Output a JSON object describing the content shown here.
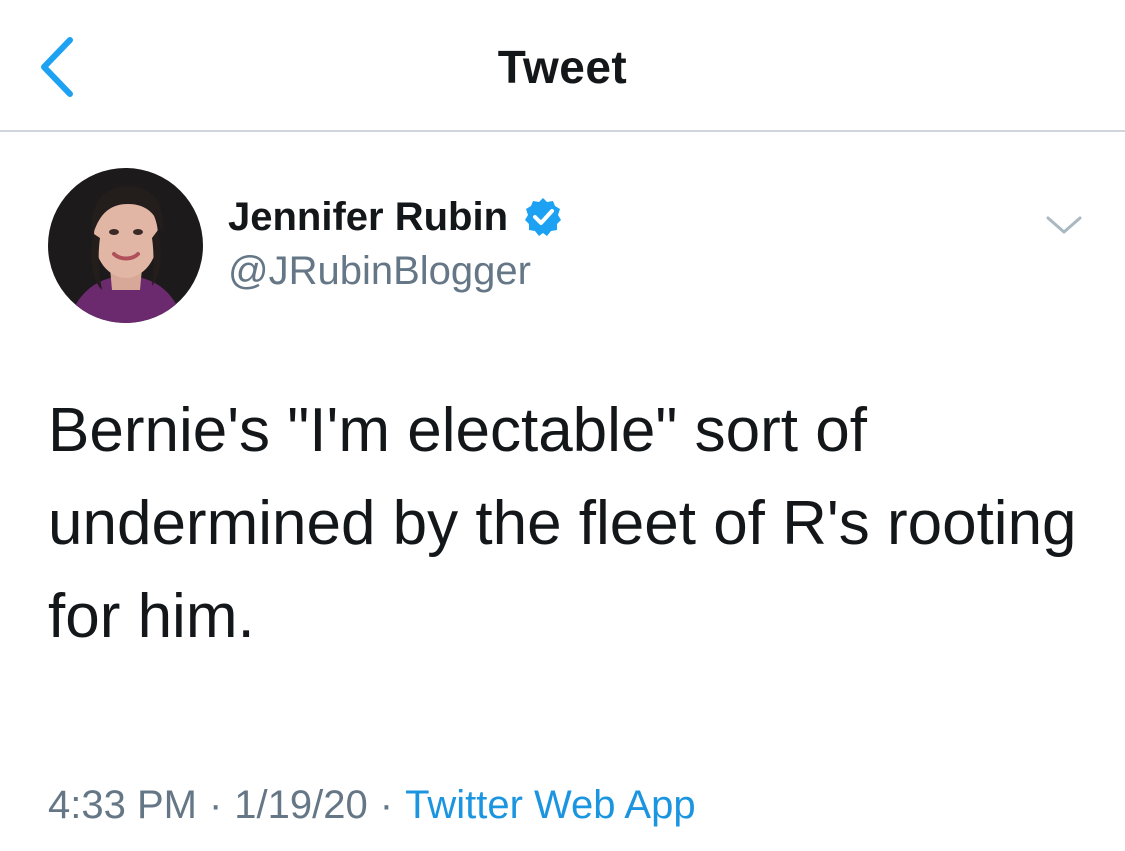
{
  "nav": {
    "title": "Tweet"
  },
  "tweet": {
    "author_name": "Jennifer Rubin",
    "verified": true,
    "handle": "@JRubinBlogger",
    "text": "Bernie's \"I'm electable\" sort of undermined by the fleet of R's rooting for him.",
    "time": "4:33 PM",
    "date": "1/19/20",
    "separator": "·",
    "source": "Twitter Web App"
  },
  "icons": {
    "back": "chevron-left-icon",
    "verified": "verified-badge-icon",
    "more": "chevron-down-icon"
  },
  "colors": {
    "accent": "#1da1f2",
    "link": "#1b95e0",
    "secondary_text": "#657786",
    "primary_text": "#14171a",
    "divider": "#cfd5da"
  }
}
